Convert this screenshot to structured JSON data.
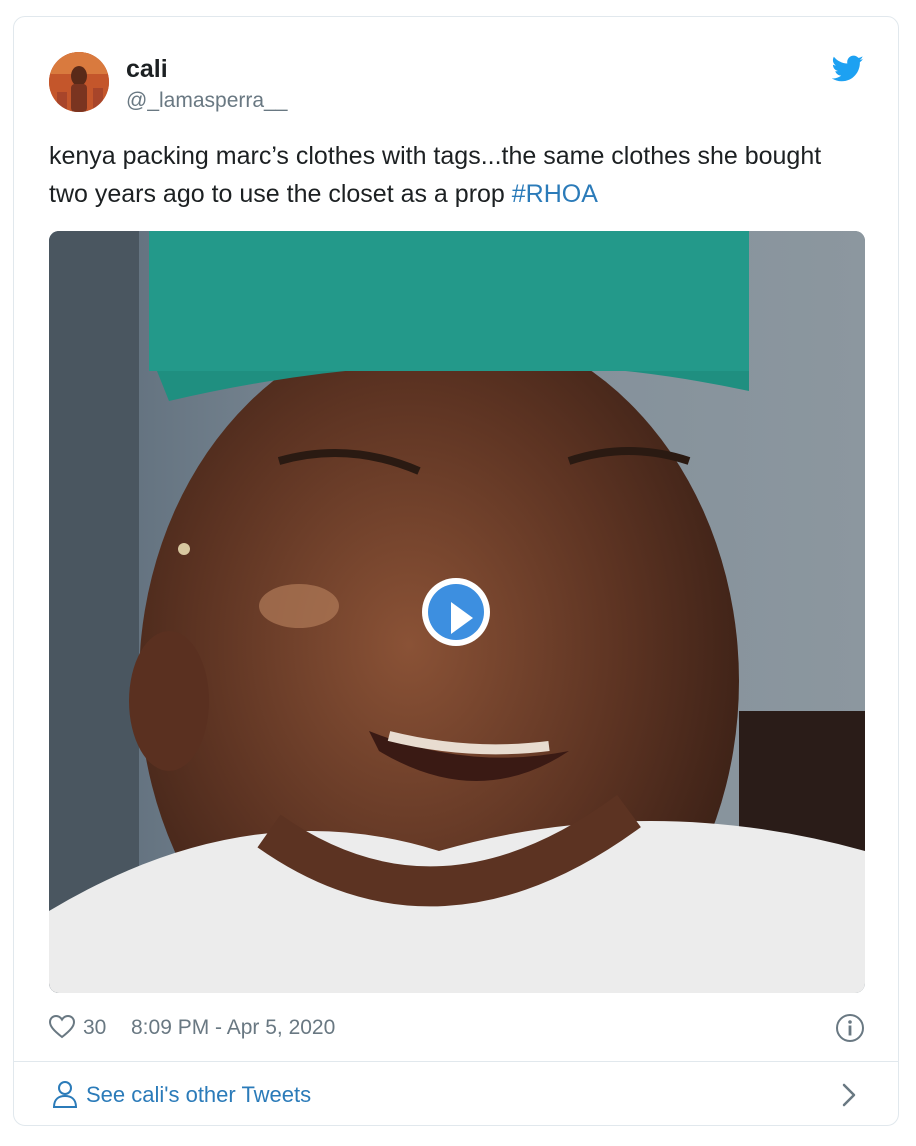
{
  "tweet": {
    "author_name": "cali",
    "author_handle": "@_lamasperra__",
    "text": "kenya packing marc’s clothes with tags...the same clothes she bought two years ago to use the closet as a prop ",
    "hashtag": "#RHOA",
    "likes": "30",
    "timestamp": "8:09 PM - Apr 5, 2020"
  },
  "footer": {
    "link_label": "See cali's other Tweets"
  },
  "icons": {
    "brand": "twitter-bird-icon",
    "like": "heart-icon",
    "info": "info-icon",
    "profile": "person-icon",
    "next": "chevron-right-icon",
    "media": "play-icon"
  },
  "colors": {
    "link": "#2b7bb9",
    "brand": "#1da1f2",
    "secondary_text": "#697882",
    "border": "#e1e8ed",
    "play": "#3d8fe0"
  }
}
